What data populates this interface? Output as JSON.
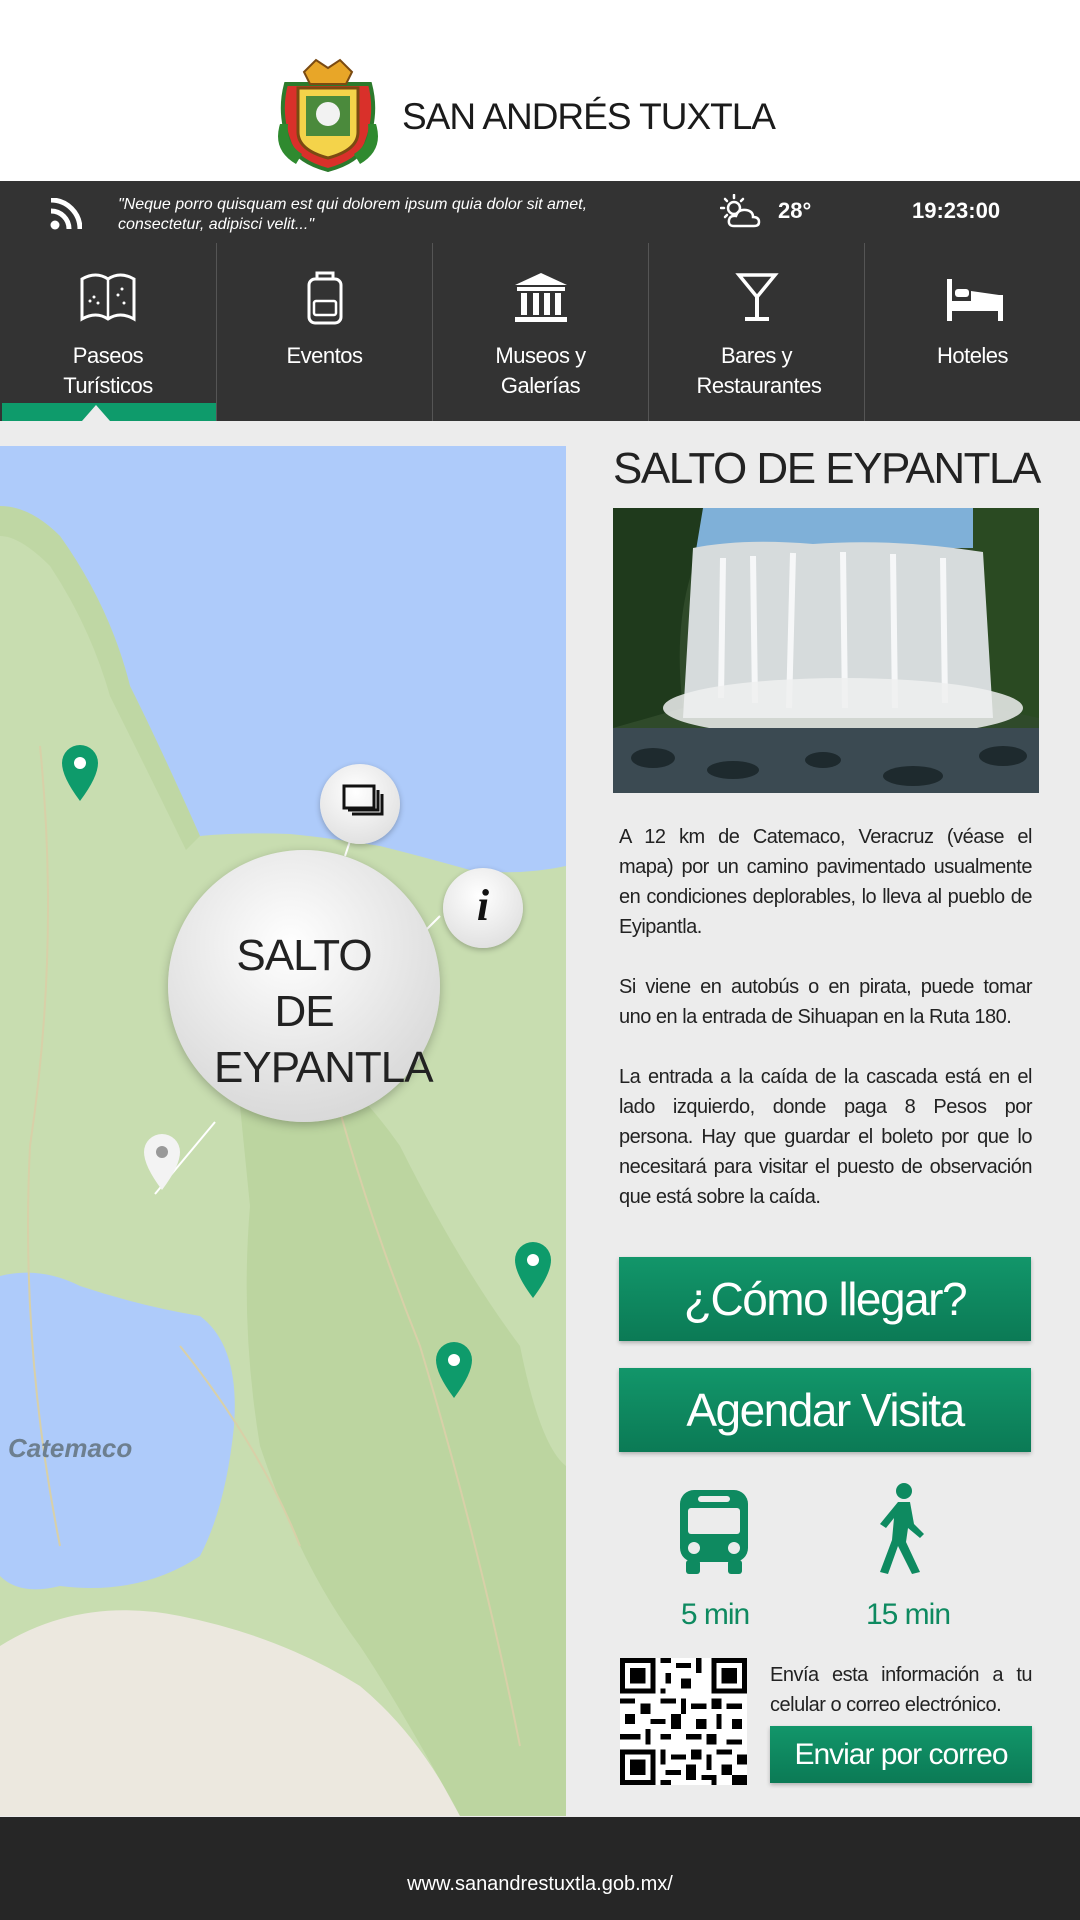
{
  "header": {
    "title": "SAN ANDRÉS TUXTLA"
  },
  "topbar": {
    "quote": "\"Neque porro quisquam est qui dolorem ipsum quia dolor sit amet, consectetur, adipisci velit...\"",
    "weather_icon": "partly-cloudy-icon",
    "temperature": "28°",
    "time": "19:23:00"
  },
  "nav": {
    "items": [
      {
        "label": "Paseos Turísticos",
        "icon": "map-book-icon",
        "active": true
      },
      {
        "label": "Eventos",
        "icon": "backpack-icon"
      },
      {
        "label": "Museos y Galerías",
        "icon": "museum-icon"
      },
      {
        "label": "Bares y Restaurantes",
        "icon": "cocktail-icon"
      },
      {
        "label": "Hoteles",
        "icon": "bed-icon"
      }
    ]
  },
  "map": {
    "lake_label": "Catemaco",
    "bubble_title": "SALTO DE EYPANTLA",
    "info_symbol": "i"
  },
  "detail": {
    "title": "SALTO DE EYPANTLA",
    "paragraphs": [
      "A 12 km de Catemaco, Veracruz (véase el mapa) por un camino pavimentado usualmente en condiciones deplorables, lo lleva al pueblo de Eyipantla.",
      "Si viene en autobús o en pirata, puede tomar uno en la entrada de Sihuapan en la Ruta 180.",
      "La entrada a la caída de la cascada está en el lado izquierdo, donde paga 8 Pesos por persona. Hay que guardar el boleto por que lo necesitará para visitar el puesto de observación que está sobre la caída."
    ],
    "btn_directions": "¿Cómo llegar?",
    "btn_schedule": "Agendar Visita",
    "bus_time": "5 min",
    "walk_time": "15 min",
    "send_text": "Envía esta información a tu celular o correo electrónico.",
    "btn_email": "Enviar por correo"
  },
  "footer": {
    "url": "www.sanandrestuxtla.gob.mx/"
  },
  "colors": {
    "accent": "#0e9b6b",
    "bar": "#333333",
    "footer": "#262626"
  }
}
